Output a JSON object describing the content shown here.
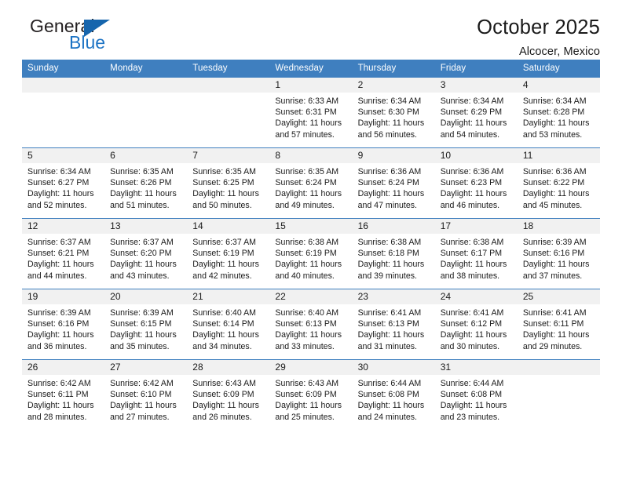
{
  "logo": {
    "word_top": "General",
    "word_bottom": "Blue",
    "accent_color": "#1665ad",
    "blue_text_color": "#1c73c4"
  },
  "header": {
    "title": "October 2025",
    "subtitle": "Alcocer, Mexico"
  },
  "theme": {
    "header_blue": "#3f7fbf",
    "daynum_bg": "#f1f1f1",
    "text": "#1a1a1a"
  },
  "calendar": {
    "weekday_headers": [
      "Sunday",
      "Monday",
      "Tuesday",
      "Wednesday",
      "Thursday",
      "Friday",
      "Saturday"
    ],
    "labels": {
      "sunrise": "Sunrise:",
      "sunset": "Sunset:",
      "daylight": "Daylight:"
    },
    "weeks": [
      [
        {
          "day": "",
          "blank": true
        },
        {
          "day": "",
          "blank": true
        },
        {
          "day": "",
          "blank": true
        },
        {
          "day": "1",
          "sunrise": "Sunrise: 6:33 AM",
          "sunset": "Sunset: 6:31 PM",
          "daylight_line1": "Daylight: 11 hours",
          "daylight_line2": "and 57 minutes."
        },
        {
          "day": "2",
          "sunrise": "Sunrise: 6:34 AM",
          "sunset": "Sunset: 6:30 PM",
          "daylight_line1": "Daylight: 11 hours",
          "daylight_line2": "and 56 minutes."
        },
        {
          "day": "3",
          "sunrise": "Sunrise: 6:34 AM",
          "sunset": "Sunset: 6:29 PM",
          "daylight_line1": "Daylight: 11 hours",
          "daylight_line2": "and 54 minutes."
        },
        {
          "day": "4",
          "sunrise": "Sunrise: 6:34 AM",
          "sunset": "Sunset: 6:28 PM",
          "daylight_line1": "Daylight: 11 hours",
          "daylight_line2": "and 53 minutes."
        }
      ],
      [
        {
          "day": "5",
          "sunrise": "Sunrise: 6:34 AM",
          "sunset": "Sunset: 6:27 PM",
          "daylight_line1": "Daylight: 11 hours",
          "daylight_line2": "and 52 minutes."
        },
        {
          "day": "6",
          "sunrise": "Sunrise: 6:35 AM",
          "sunset": "Sunset: 6:26 PM",
          "daylight_line1": "Daylight: 11 hours",
          "daylight_line2": "and 51 minutes."
        },
        {
          "day": "7",
          "sunrise": "Sunrise: 6:35 AM",
          "sunset": "Sunset: 6:25 PM",
          "daylight_line1": "Daylight: 11 hours",
          "daylight_line2": "and 50 minutes."
        },
        {
          "day": "8",
          "sunrise": "Sunrise: 6:35 AM",
          "sunset": "Sunset: 6:24 PM",
          "daylight_line1": "Daylight: 11 hours",
          "daylight_line2": "and 49 minutes."
        },
        {
          "day": "9",
          "sunrise": "Sunrise: 6:36 AM",
          "sunset": "Sunset: 6:24 PM",
          "daylight_line1": "Daylight: 11 hours",
          "daylight_line2": "and 47 minutes."
        },
        {
          "day": "10",
          "sunrise": "Sunrise: 6:36 AM",
          "sunset": "Sunset: 6:23 PM",
          "daylight_line1": "Daylight: 11 hours",
          "daylight_line2": "and 46 minutes."
        },
        {
          "day": "11",
          "sunrise": "Sunrise: 6:36 AM",
          "sunset": "Sunset: 6:22 PM",
          "daylight_line1": "Daylight: 11 hours",
          "daylight_line2": "and 45 minutes."
        }
      ],
      [
        {
          "day": "12",
          "sunrise": "Sunrise: 6:37 AM",
          "sunset": "Sunset: 6:21 PM",
          "daylight_line1": "Daylight: 11 hours",
          "daylight_line2": "and 44 minutes."
        },
        {
          "day": "13",
          "sunrise": "Sunrise: 6:37 AM",
          "sunset": "Sunset: 6:20 PM",
          "daylight_line1": "Daylight: 11 hours",
          "daylight_line2": "and 43 minutes."
        },
        {
          "day": "14",
          "sunrise": "Sunrise: 6:37 AM",
          "sunset": "Sunset: 6:19 PM",
          "daylight_line1": "Daylight: 11 hours",
          "daylight_line2": "and 42 minutes."
        },
        {
          "day": "15",
          "sunrise": "Sunrise: 6:38 AM",
          "sunset": "Sunset: 6:19 PM",
          "daylight_line1": "Daylight: 11 hours",
          "daylight_line2": "and 40 minutes."
        },
        {
          "day": "16",
          "sunrise": "Sunrise: 6:38 AM",
          "sunset": "Sunset: 6:18 PM",
          "daylight_line1": "Daylight: 11 hours",
          "daylight_line2": "and 39 minutes."
        },
        {
          "day": "17",
          "sunrise": "Sunrise: 6:38 AM",
          "sunset": "Sunset: 6:17 PM",
          "daylight_line1": "Daylight: 11 hours",
          "daylight_line2": "and 38 minutes."
        },
        {
          "day": "18",
          "sunrise": "Sunrise: 6:39 AM",
          "sunset": "Sunset: 6:16 PM",
          "daylight_line1": "Daylight: 11 hours",
          "daylight_line2": "and 37 minutes."
        }
      ],
      [
        {
          "day": "19",
          "sunrise": "Sunrise: 6:39 AM",
          "sunset": "Sunset: 6:16 PM",
          "daylight_line1": "Daylight: 11 hours",
          "daylight_line2": "and 36 minutes."
        },
        {
          "day": "20",
          "sunrise": "Sunrise: 6:39 AM",
          "sunset": "Sunset: 6:15 PM",
          "daylight_line1": "Daylight: 11 hours",
          "daylight_line2": "and 35 minutes."
        },
        {
          "day": "21",
          "sunrise": "Sunrise: 6:40 AM",
          "sunset": "Sunset: 6:14 PM",
          "daylight_line1": "Daylight: 11 hours",
          "daylight_line2": "and 34 minutes."
        },
        {
          "day": "22",
          "sunrise": "Sunrise: 6:40 AM",
          "sunset": "Sunset: 6:13 PM",
          "daylight_line1": "Daylight: 11 hours",
          "daylight_line2": "and 33 minutes."
        },
        {
          "day": "23",
          "sunrise": "Sunrise: 6:41 AM",
          "sunset": "Sunset: 6:13 PM",
          "daylight_line1": "Daylight: 11 hours",
          "daylight_line2": "and 31 minutes."
        },
        {
          "day": "24",
          "sunrise": "Sunrise: 6:41 AM",
          "sunset": "Sunset: 6:12 PM",
          "daylight_line1": "Daylight: 11 hours",
          "daylight_line2": "and 30 minutes."
        },
        {
          "day": "25",
          "sunrise": "Sunrise: 6:41 AM",
          "sunset": "Sunset: 6:11 PM",
          "daylight_line1": "Daylight: 11 hours",
          "daylight_line2": "and 29 minutes."
        }
      ],
      [
        {
          "day": "26",
          "sunrise": "Sunrise: 6:42 AM",
          "sunset": "Sunset: 6:11 PM",
          "daylight_line1": "Daylight: 11 hours",
          "daylight_line2": "and 28 minutes."
        },
        {
          "day": "27",
          "sunrise": "Sunrise: 6:42 AM",
          "sunset": "Sunset: 6:10 PM",
          "daylight_line1": "Daylight: 11 hours",
          "daylight_line2": "and 27 minutes."
        },
        {
          "day": "28",
          "sunrise": "Sunrise: 6:43 AM",
          "sunset": "Sunset: 6:09 PM",
          "daylight_line1": "Daylight: 11 hours",
          "daylight_line2": "and 26 minutes."
        },
        {
          "day": "29",
          "sunrise": "Sunrise: 6:43 AM",
          "sunset": "Sunset: 6:09 PM",
          "daylight_line1": "Daylight: 11 hours",
          "daylight_line2": "and 25 minutes."
        },
        {
          "day": "30",
          "sunrise": "Sunrise: 6:44 AM",
          "sunset": "Sunset: 6:08 PM",
          "daylight_line1": "Daylight: 11 hours",
          "daylight_line2": "and 24 minutes."
        },
        {
          "day": "31",
          "sunrise": "Sunrise: 6:44 AM",
          "sunset": "Sunset: 6:08 PM",
          "daylight_line1": "Daylight: 11 hours",
          "daylight_line2": "and 23 minutes."
        },
        {
          "day": "",
          "blank": true
        }
      ]
    ]
  }
}
